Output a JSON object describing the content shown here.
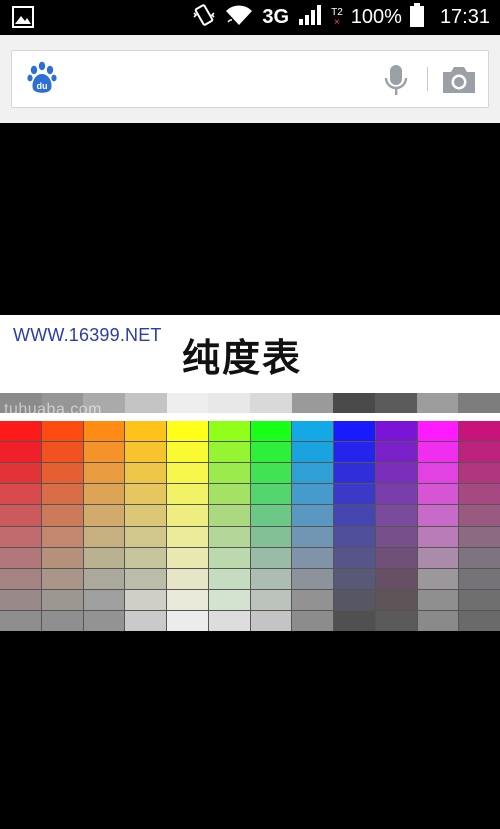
{
  "status_bar": {
    "network": "3G",
    "sim2_label": "T2",
    "sim2_x": "×",
    "battery": "100%",
    "time": "17:31",
    "icons": [
      "image-icon",
      "vibrate-icon",
      "wifi-icon",
      "signal-icon",
      "battery-icon"
    ]
  },
  "search": {
    "value": "",
    "placeholder": "",
    "icons": [
      "baidu-paw-icon",
      "microphone-icon",
      "camera-icon"
    ]
  },
  "image": {
    "url_text": "WWW.16399.NET",
    "title": "纯度表",
    "watermark": "tuhuaba.com",
    "gray_swatches": [
      "#8b8b8b",
      "#969696",
      "#aaaaaa",
      "#c4c4c4",
      "#eeeeee",
      "#e8e8e8",
      "#d9d9d9",
      "#9a9a9a",
      "#4a4a4a",
      "#5b5b5b",
      "#9d9d9d",
      "#7d7d7d"
    ],
    "hue_columns": [
      {
        "hue": "red",
        "colors": [
          "#ff1a1a",
          "#f01f2a",
          "#e23336",
          "#d94a4d",
          "#cc5a5c",
          "#c06a6b",
          "#b27879",
          "#a68383",
          "#9a8989",
          "#8d8d8d"
        ]
      },
      {
        "hue": "red-orange",
        "colors": [
          "#ff4a10",
          "#f2521f",
          "#e55f32",
          "#d96d47",
          "#cd7a5b",
          "#c2876c",
          "#b5917c",
          "#a99688",
          "#9c9891",
          "#8f8f8f"
        ]
      },
      {
        "hue": "orange",
        "colors": [
          "#ff8a14",
          "#f59229",
          "#e99b3f",
          "#dda457",
          "#d2ab6c",
          "#c6b07f",
          "#b9b18f",
          "#aaa99b",
          "#9f9f9f",
          "#939393"
        ]
      },
      {
        "hue": "amber",
        "colors": [
          "#ffc21a",
          "#f7c42f",
          "#efc547",
          "#e6c65f",
          "#dcc776",
          "#d1c78b",
          "#c6c69c",
          "#bcbcaa",
          "#cfcfc8",
          "#cacaca"
        ]
      },
      {
        "hue": "yellow",
        "colors": [
          "#ffff1a",
          "#fafa33",
          "#f6f64d",
          "#f2f266",
          "#eeee80",
          "#ebeb99",
          "#e8e8b0",
          "#e6e6c6",
          "#eaeada",
          "#ececec"
        ]
      },
      {
        "hue": "yellow-green",
        "colors": [
          "#8fff1a",
          "#96f533",
          "#9ceb4d",
          "#a4e266",
          "#abd980",
          "#b3d699",
          "#bcd8ad",
          "#c6dcc0",
          "#d4e2d0",
          "#dddddd"
        ]
      },
      {
        "hue": "green",
        "colors": [
          "#1aff1a",
          "#2ef03a",
          "#42e255",
          "#55d56e",
          "#6cc985",
          "#83c096",
          "#98bca6",
          "#acbdb1",
          "#bcc3bd",
          "#c4c4c4"
        ]
      },
      {
        "hue": "cyan-blue",
        "colors": [
          "#14a8e6",
          "#1aa3df",
          "#2f9fd6",
          "#469bcc",
          "#5b98c1",
          "#7096b5",
          "#8093a8",
          "#8d939b",
          "#929292",
          "#8c8c8c"
        ]
      },
      {
        "hue": "blue",
        "colors": [
          "#1a1aff",
          "#2424ec",
          "#2f2fda",
          "#3a3ac6",
          "#4646b2",
          "#4f4f9e",
          "#55558a",
          "#585877",
          "#565664",
          "#505050"
        ]
      },
      {
        "hue": "violet",
        "colors": [
          "#7a14d6",
          "#7a20c8",
          "#7a2ebb",
          "#7a3dac",
          "#7a4b9c",
          "#774f8a",
          "#705078",
          "#675065",
          "#5e5357",
          "#5a5a5a"
        ]
      },
      {
        "hue": "magenta",
        "colors": [
          "#ff1aff",
          "#f02ef0",
          "#e242e2",
          "#d555d5",
          "#c86ac8",
          "#b97cb9",
          "#aa8caa",
          "#9b979b",
          "#8f8f8f",
          "#8a8a8a"
        ]
      },
      {
        "hue": "crimson",
        "colors": [
          "#c8147a",
          "#bd237c",
          "#b2357f",
          "#a64881",
          "#995a82",
          "#8c6a82",
          "#7e747f",
          "#757377",
          "#6f6f6f",
          "#6a6a6a"
        ]
      }
    ]
  }
}
